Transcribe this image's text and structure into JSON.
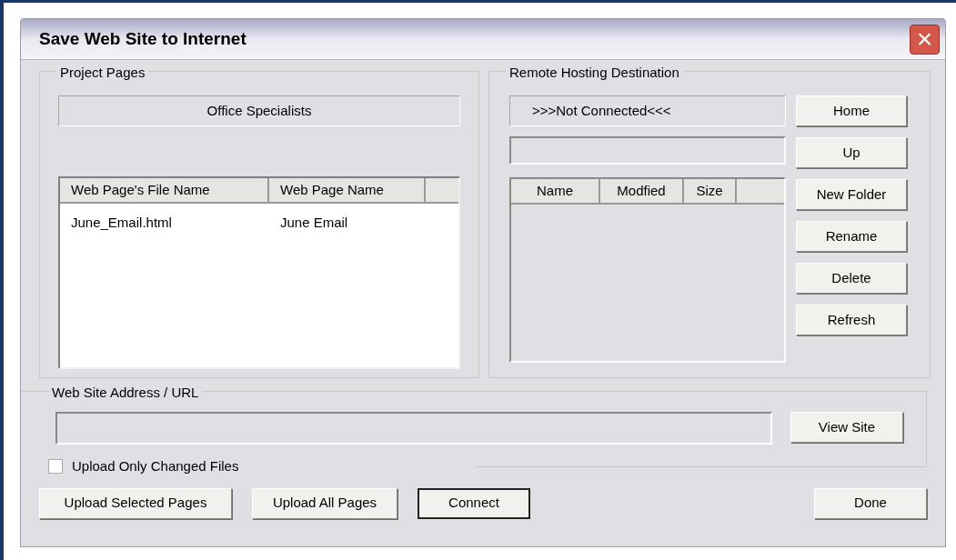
{
  "window": {
    "title": "Save Web Site to Internet",
    "close": "×"
  },
  "project_pages": {
    "label": "Project Pages",
    "project_name": "Office Specialists",
    "columns": [
      "Web Page's File Name",
      "Web Page Name"
    ],
    "rows": [
      {
        "cells": [
          "June_Email.html",
          "June Email"
        ],
        "selected": false
      }
    ]
  },
  "remote": {
    "label": "Remote Hosting Destination",
    "status": ">>>Not Connected<<<",
    "columns": [
      "Name",
      "Modfied",
      "Size"
    ],
    "buttons": [
      "Home",
      "Up",
      "New Folder",
      "Rename",
      "Delete",
      "Refresh"
    ]
  },
  "url": {
    "label": "Web Site Address / URL",
    "button": "View Site"
  },
  "upload_only_changed": {
    "label": "Upload Only Changed Files",
    "checked": false
  },
  "buttons": [
    {
      "label": "Upload Selected Pages",
      "default": false
    },
    {
      "label": "Upload All Pages",
      "default": false
    },
    {
      "label": "Connect",
      "default": true
    },
    {
      "label": "Done",
      "default": false
    }
  ]
}
